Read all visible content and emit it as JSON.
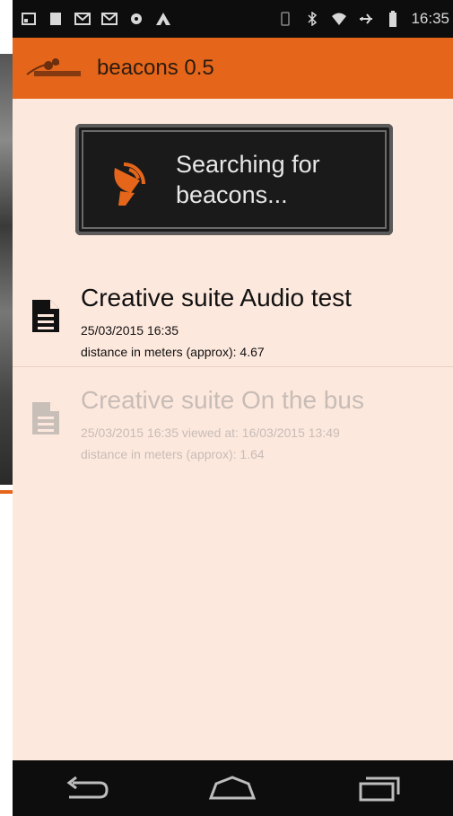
{
  "status_bar": {
    "time": "16:35",
    "icons": [
      "screenshot-icon",
      "notification-icon",
      "gmail-icon",
      "gmail-icon",
      "record-icon",
      "app-icon",
      "vibrate-icon",
      "bluetooth-icon",
      "wifi-icon",
      "airplane-icon",
      "battery-icon"
    ]
  },
  "action_bar": {
    "title": "beacons 0.5",
    "accent_color": "#e5661a"
  },
  "search_button": {
    "label": "Searching for beacons...",
    "icon": "satellite-dish-icon"
  },
  "beacons": [
    {
      "title": "Creative suite Audio test",
      "timestamp": "25/03/2015 16:35",
      "distance": "distance in meters (approx): 4.67",
      "state": "new"
    },
    {
      "title": "Creative suite On the bus",
      "timestamp": "25/03/2015 16:35 viewed at: 16/03/2015 13:49",
      "distance": "distance in meters (approx): 1.64",
      "state": "viewed"
    }
  ],
  "nav_bar": {
    "buttons": [
      "back-icon",
      "home-icon",
      "recents-icon"
    ]
  },
  "colors": {
    "content_bg": "#fde8dd",
    "bars": "#0d0d0d"
  }
}
